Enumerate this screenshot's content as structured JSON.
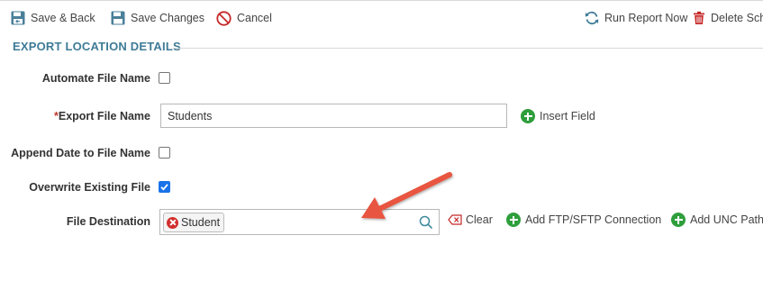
{
  "toolbar": {
    "save_back": "Save & Back",
    "save_changes": "Save Changes",
    "cancel": "Cancel",
    "run_report_now": "Run Report Now",
    "delete_schedule": "Delete Sche"
  },
  "section": {
    "title": "EXPORT LOCATION DETAILS"
  },
  "form": {
    "automate_file_name": {
      "label": "Automate File Name",
      "checked": false
    },
    "export_file_name": {
      "required_mark": "*",
      "label": "Export File Name",
      "value": "Students",
      "insert_field": "Insert Field"
    },
    "append_date": {
      "label": "Append Date to File Name",
      "checked": false
    },
    "overwrite_existing": {
      "label": "Overwrite Existing File",
      "checked": true
    },
    "file_destination": {
      "label": "File Destination",
      "tag": "Student",
      "clear": "Clear",
      "add_ftp": "Add FTP/SFTP Connection",
      "add_unc": "Add UNC Path"
    }
  },
  "colors": {
    "section_title": "#3e7b96",
    "accent_green": "#2e9e3c",
    "cancel_red": "#c62828",
    "checkbox_blue": "#1a73e8",
    "annotation_arrow": "#e8553f"
  }
}
